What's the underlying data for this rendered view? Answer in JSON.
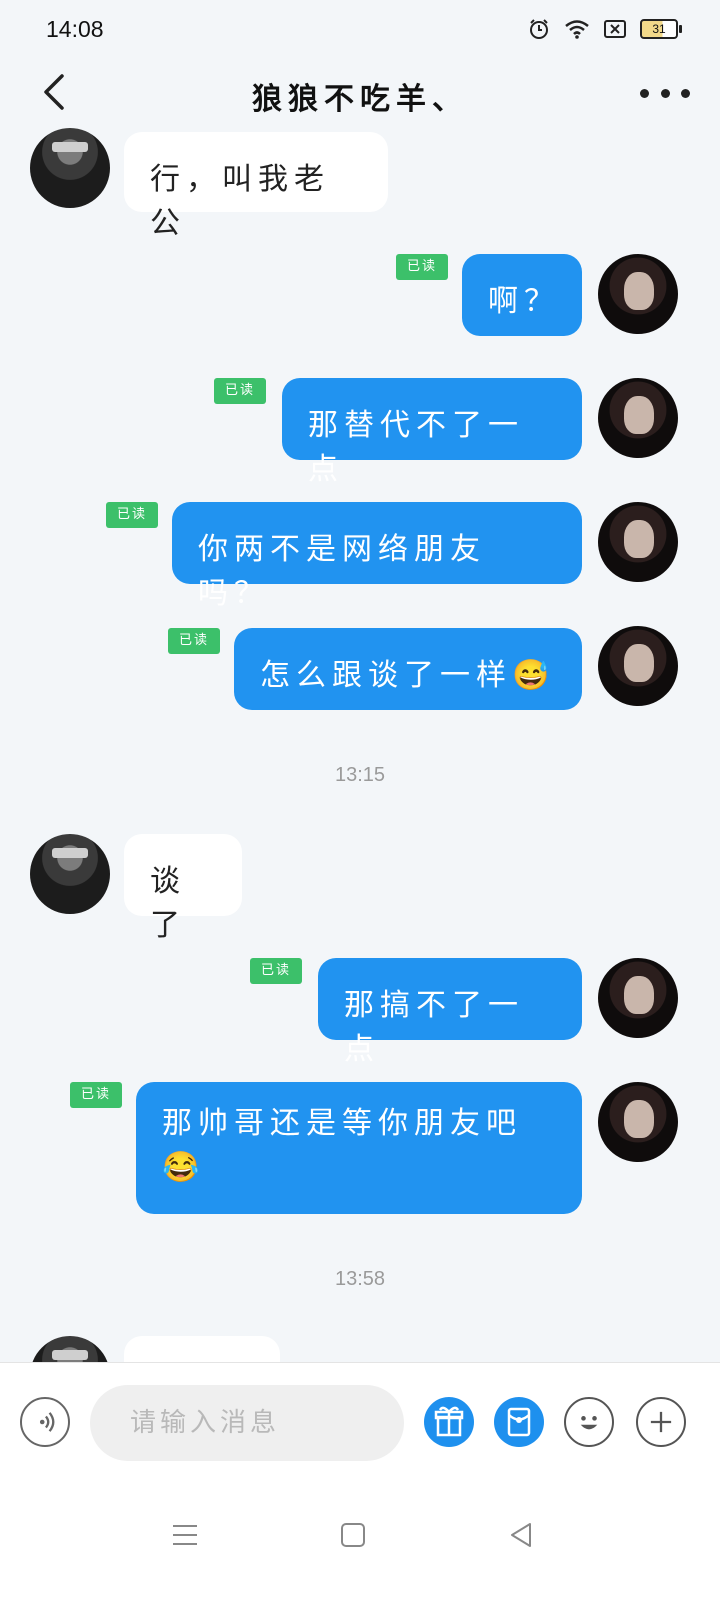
{
  "status": {
    "time": "14:08",
    "battery": "31"
  },
  "header": {
    "title": "狼狼不吃羊、"
  },
  "messages": [
    {
      "text": "行，叫我老公"
    },
    {
      "text": "啊？",
      "read": "已读"
    },
    {
      "text": "那替代不了一点",
      "read": "已读"
    },
    {
      "text": "你两不是网络朋友吗？",
      "read": "已读"
    },
    {
      "text": "怎么跟谈了一样😅",
      "read": "已读"
    },
    {
      "text": "谈了"
    },
    {
      "text": "那搞不了一点",
      "read": "已读"
    },
    {
      "text_line1": "那帅哥还是等你朋友吧",
      "text_line2": "😂",
      "read": "已读"
    }
  ],
  "timestamps": [
    "13:15",
    "13:58"
  ],
  "composer": {
    "placeholder": "请输入消息"
  },
  "colors": {
    "accent": "#2193f0",
    "read_badge": "#3cc06a",
    "background": "#f3f6f9"
  }
}
